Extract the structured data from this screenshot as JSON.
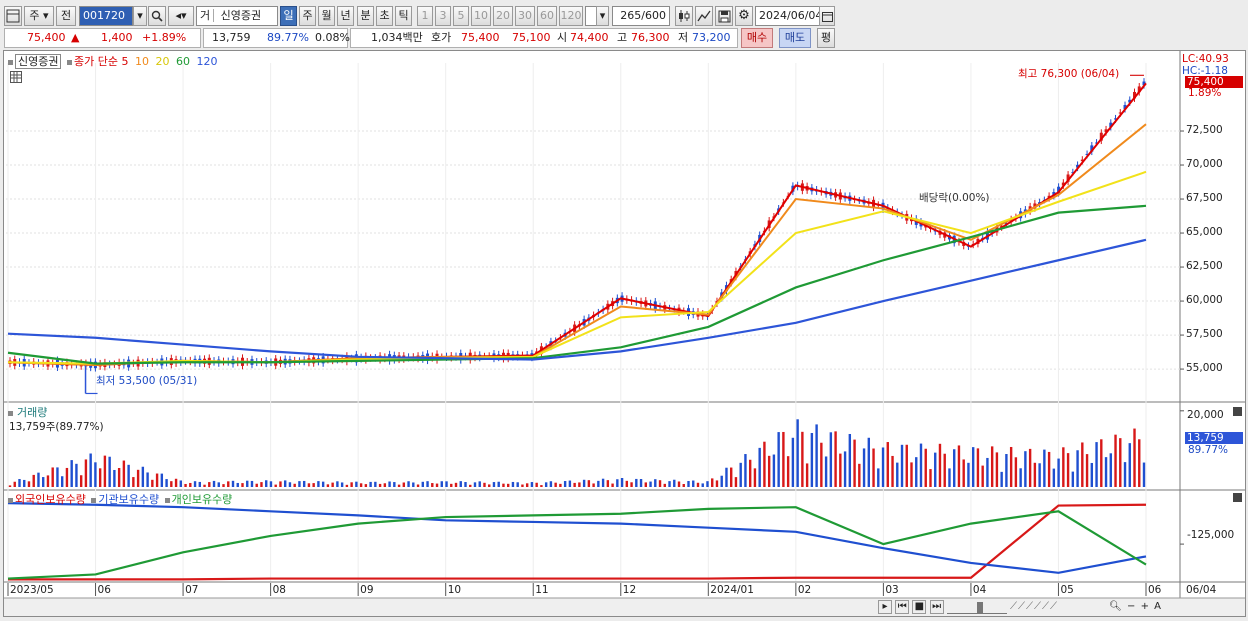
{
  "toolbar": {
    "mode1": "주",
    "mode2": "전",
    "code": "001720",
    "market_tag": "거",
    "stock_name": "신영증권",
    "periods": [
      "일",
      "주",
      "월",
      "년",
      "분",
      "초",
      "틱"
    ],
    "intervals": [
      "1",
      "3",
      "5",
      "10",
      "20",
      "30",
      "60",
      "120"
    ],
    "count_current": "265",
    "count_total": "/600",
    "date": "2024/06/04"
  },
  "quote": {
    "price": "75,400",
    "arrow": "▲",
    "change": "1,400",
    "change_pct": "+1.89%",
    "volume": "13,759",
    "vol_ratio": "89.77%",
    "turnover": "0.08%",
    "amount": "1,034백만",
    "hoga_label": "호가",
    "ask": "75,400",
    "bid": "75,100",
    "open_label": "시",
    "open": "74,400",
    "high_label": "고",
    "high": "76,300",
    "low_label": "저",
    "low": "73,200",
    "buy_btn": "매수",
    "sell_btn": "매도",
    "eval_btn": "평"
  },
  "price_panel": {
    "name_tag": "신영증권",
    "legend_close": "종가 단순",
    "ma_periods": [
      "5",
      "10",
      "20",
      "60",
      "120"
    ],
    "lc": "LC:40.93",
    "hc": "HC:-1.18",
    "current_box": "75,400",
    "current_pct": "1.89%",
    "high_note": "최고 76,300 (06/04)",
    "low_note": "최저 53,500 (05/31)",
    "event_note": "배당락(0.00%)"
  },
  "volume_panel": {
    "title": "거래량",
    "summary": "13,759주(89.77%)",
    "scale_label": "20,000",
    "current_box": "13,759",
    "current_pct": "89.77%"
  },
  "holdings_panel": {
    "legend": [
      "외국인보유수량",
      "기관보유수량",
      "개인보유수량"
    ],
    "scale_label": "-125,000"
  },
  "xaxis": {
    "labels": [
      "2023/05",
      "06",
      "07",
      "08",
      "09",
      "10",
      "11",
      "12",
      "2024/01",
      "02",
      "03",
      "04",
      "05",
      "06"
    ],
    "right_label": "06/04"
  },
  "colors": {
    "ma5": "#e00000",
    "ma10": "#f08a1c",
    "ma20": "#f2e21a",
    "ma60": "#1f9a35",
    "ma120": "#2d55d8",
    "up": "#d81818",
    "down": "#1f4fd0"
  },
  "chart_data": {
    "type": "line",
    "title": "",
    "ylim": [
      52800,
      77500
    ],
    "yticks": [
      55000,
      57500,
      60000,
      62500,
      65000,
      67500,
      70000,
      72500
    ],
    "ytick_labels": [
      "55,000",
      "57,500",
      "60,000",
      "62,500",
      "65,000",
      "67,500",
      "70,000",
      "72,500"
    ],
    "x": [
      "2023/05",
      "2023/06",
      "2023/07",
      "2023/08",
      "2023/09",
      "2023/10",
      "2023/11",
      "2023/12",
      "2024/01",
      "2024/02",
      "2024/03",
      "2024/04",
      "2024/05",
      "2024/06"
    ],
    "series": [
      {
        "name": "5",
        "values": [
          55500,
          55300,
          55600,
          55500,
          55800,
          55900,
          56000,
          60200,
          58900,
          68500,
          67000,
          64000,
          68000,
          76000
        ]
      },
      {
        "name": "10",
        "values": [
          55500,
          55300,
          55600,
          55500,
          55800,
          55900,
          55900,
          59600,
          59000,
          67500,
          66800,
          64500,
          67800,
          73000
        ]
      },
      {
        "name": "20",
        "values": [
          55500,
          55400,
          55600,
          55500,
          55700,
          55800,
          55900,
          58800,
          59200,
          65000,
          66600,
          65000,
          67300,
          69500
        ]
      },
      {
        "name": "60",
        "values": [
          56200,
          55400,
          55500,
          55500,
          55600,
          55700,
          55800,
          56600,
          58100,
          61000,
          63000,
          64700,
          66500,
          67000
        ]
      },
      {
        "name": "120",
        "values": [
          57600,
          57300,
          56800,
          56300,
          55900,
          55800,
          55700,
          56300,
          57300,
          58400,
          60000,
          61500,
          63000,
          64500
        ]
      }
    ],
    "volume": {
      "ylim": [
        0,
        21000
      ],
      "values": [
        1200,
        9500,
        1500,
        1800,
        1400,
        1600,
        1300,
        2400,
        1600,
        18000,
        12000,
        11000,
        10000,
        16000
      ]
    },
    "holdings": {
      "series": [
        {
          "name": "외국인보유수량",
          "values": [
            0.02,
            0.02,
            0.02,
            0.03,
            0.03,
            0.03,
            0.03,
            0.03,
            0.03,
            0.04,
            0.04,
            0.04,
            0.92,
            0.93
          ]
        },
        {
          "name": "기관보유수량",
          "values": [
            0.95,
            0.93,
            0.9,
            0.85,
            0.8,
            0.74,
            0.72,
            0.7,
            0.65,
            0.6,
            0.4,
            0.22,
            0.1,
            0.3
          ]
        },
        {
          "name": "개인보유수량",
          "values": [
            0.03,
            0.08,
            0.35,
            0.55,
            0.7,
            0.78,
            0.8,
            0.82,
            0.88,
            0.9,
            0.45,
            0.7,
            0.85,
            0.2
          ]
        }
      ]
    }
  }
}
